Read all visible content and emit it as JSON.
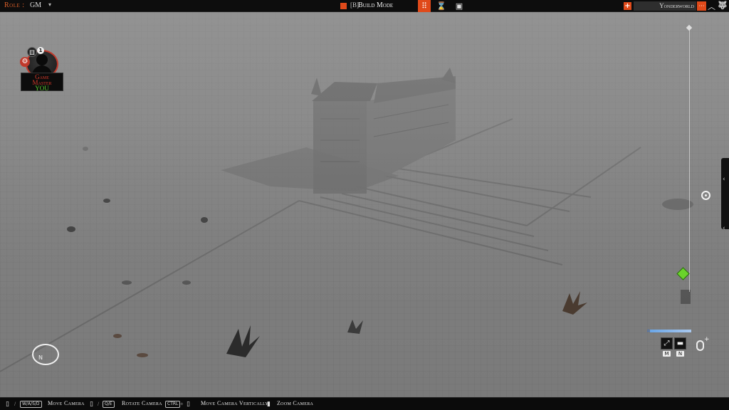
{
  "topbar": {
    "role_label": "Role :",
    "role_value": "GM",
    "role_chevron": "▾",
    "mode_key": "[B]",
    "mode_label": "Build Mode",
    "mode_color": "#e04a1a",
    "tools": [
      {
        "name": "build-tool-button",
        "icon": "footsteps-icon",
        "glyph": "⠿",
        "active": true
      },
      {
        "name": "time-tool-button",
        "icon": "hourglass-icon",
        "glyph": "⌛",
        "active": false
      },
      {
        "name": "cinematic-tool-button",
        "icon": "film-frame-icon",
        "glyph": "▣",
        "active": false
      }
    ],
    "add_glyph": "+",
    "world_name": "Yonderworld",
    "world_menu_glyph": "···",
    "collapse_glyph": "︿",
    "wolf_glyph": "🐺"
  },
  "player_card": {
    "line1": "Game",
    "line2": "Master",
    "line3": "YOU",
    "cog_glyph": "⚙",
    "dice_glyph": "⚅",
    "token_glyph": "1"
  },
  "tool_panel": {
    "measure_glyph": "⤢",
    "line_glyph": "▬",
    "measure_key": "M",
    "line_key": "N"
  },
  "side_panel": {
    "chevron1": "‹",
    "chevron2": "‹"
  },
  "compass": {
    "n_glyph": "N"
  },
  "bottombar": {
    "hints": [
      {
        "label": "Move Camera"
      },
      {
        "label": "Rotate Camera"
      },
      {
        "label": "Move Camera Vertically"
      },
      {
        "label": "Zoom Camera"
      }
    ],
    "keys": {
      "wasd": "W/A/S/D",
      "qe": "Q/E",
      "ctrl": "CTRL",
      "plus": "+",
      "slash": "/"
    }
  }
}
